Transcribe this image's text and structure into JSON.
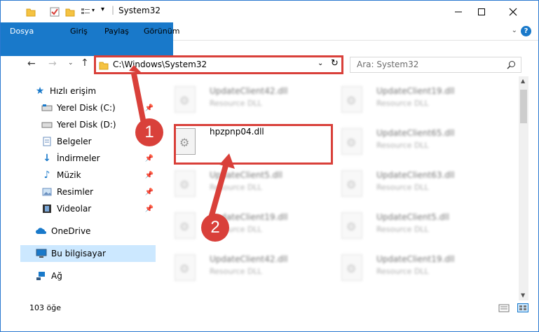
{
  "window": {
    "title": "System32"
  },
  "ribbon": {
    "tabs": [
      {
        "label": "Dosya"
      },
      {
        "label": "Giriş"
      },
      {
        "label": "Paylaş"
      },
      {
        "label": "Görünüm"
      }
    ],
    "help": "?"
  },
  "nav": {
    "address": "C:\\Windows\\System32",
    "search_placeholder": "Ara: System32"
  },
  "sidebar": {
    "items": [
      {
        "label": "Hızlı erişim"
      },
      {
        "label": "Yerel Disk (C:)"
      },
      {
        "label": "Yerel Disk (D:)"
      },
      {
        "label": "Belgeler"
      },
      {
        "label": "İndirmeler"
      },
      {
        "label": "Müzik"
      },
      {
        "label": "Resimler"
      },
      {
        "label": "Videolar"
      },
      {
        "label": "OneDrive"
      },
      {
        "label": "Bu bilgisayar"
      },
      {
        "label": "Ağ"
      }
    ]
  },
  "files": {
    "highlighted": {
      "name": "hpzpnp04.dll"
    },
    "others": [
      {
        "name": "UpdateClient42.dll",
        "type": "Resource DLL"
      },
      {
        "name": "UpdateClient19.dll",
        "type": "Resource DLL"
      },
      {
        "name": "UpdateClient65.dll",
        "type": "Resource DLL"
      },
      {
        "name": "UpdateClient5.dll",
        "type": "Resource DLL"
      },
      {
        "name": "UpdateClient63.dll",
        "type": "Resource DLL"
      },
      {
        "name": "UpdateClient19.dll",
        "type": "Resource DLL"
      },
      {
        "name": "UpdateClient5.dll",
        "type": "Resource DLL"
      },
      {
        "name": "UpdateClient42.dll",
        "type": "Resource DLL"
      },
      {
        "name": "UpdateClient19.dll",
        "type": "Resource DLL"
      }
    ]
  },
  "status": {
    "count": "103 öğe"
  },
  "annotations": {
    "step1": "1",
    "step2": "2",
    "color": "#d9403a"
  }
}
